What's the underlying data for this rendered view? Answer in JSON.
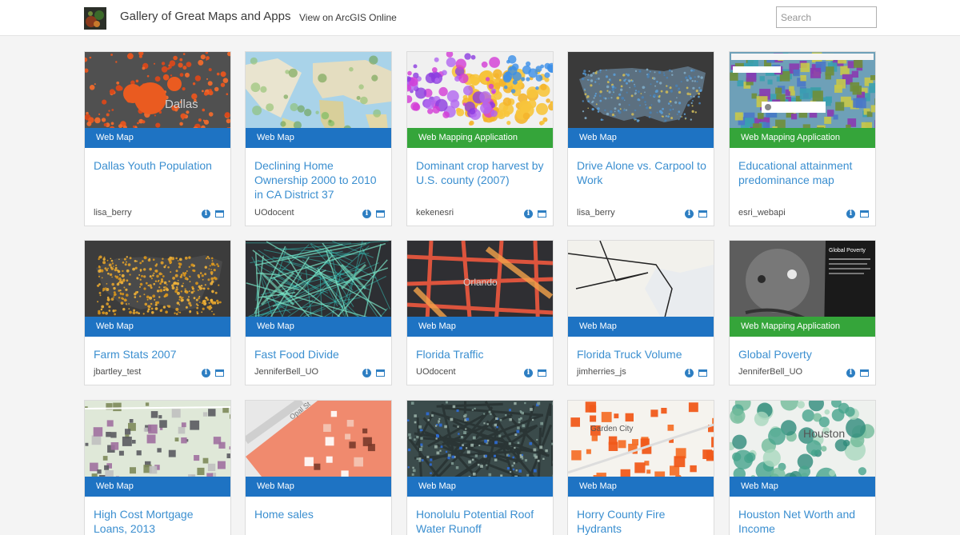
{
  "header": {
    "title": "Gallery of Great Maps and Apps",
    "view_link": "View on ArcGIS Online",
    "search_placeholder": "Search"
  },
  "colors": {
    "web_map_ribbon": "#1e73c3",
    "app_ribbon": "#35a53a",
    "title_link": "#3b8fd0",
    "icon_blue": "#2d7ec2"
  },
  "icons": {
    "info": "info-icon",
    "details": "details-icon",
    "logo": "gallery-logo"
  },
  "cards": [
    {
      "type": "Web Map",
      "title": "Dallas Youth Population",
      "owner": "lisa_berry",
      "thumb": "dallas"
    },
    {
      "type": "Web Map",
      "title": "Declining Home Ownership 2000 to 2010 in CA District 37",
      "owner": "UOdocent",
      "thumb": "world"
    },
    {
      "type": "Web Mapping Application",
      "title": "Dominant crop harvest by U.S. county (2007)",
      "owner": "kekenesri",
      "thumb": "crop"
    },
    {
      "type": "Web Map",
      "title": "Drive Alone vs. Carpool to Work",
      "owner": "lisa_berry",
      "thumb": "usdark"
    },
    {
      "type": "Web Mapping Application",
      "title": "Educational attainment predominance map",
      "owner": "esri_webapi",
      "thumb": "edu"
    },
    {
      "type": "Web Map",
      "title": "Farm Stats 2007",
      "owner": "jbartley_test",
      "thumb": "farm"
    },
    {
      "type": "Web Map",
      "title": "Fast Food Divide",
      "owner": "JenniferBell_UO",
      "thumb": "fastfood"
    },
    {
      "type": "Web Map",
      "title": "Florida Traffic",
      "owner": "UOdocent",
      "thumb": "traffic"
    },
    {
      "type": "Web Map",
      "title": "Florida Truck Volume",
      "owner": "jimherries_js",
      "thumb": "truck"
    },
    {
      "type": "Web Mapping Application",
      "title": "Global Poverty",
      "owner": "JenniferBell_UO",
      "thumb": "poverty"
    },
    {
      "type": "Web Map",
      "title": "High Cost Mortgage Loans, 2013",
      "owner": "",
      "thumb": "mortgage"
    },
    {
      "type": "Web Map",
      "title": "Home sales",
      "owner": "",
      "thumb": "homesales"
    },
    {
      "type": "Web Map",
      "title": "Honolulu Potential Roof Water Runoff",
      "owner": "",
      "thumb": "honolulu"
    },
    {
      "type": "Web Map",
      "title": "Horry County Fire Hydrants",
      "owner": "",
      "thumb": "horry"
    },
    {
      "type": "Web Map",
      "title": "Houston Net Worth and Income",
      "owner": "",
      "thumb": "houston"
    }
  ],
  "thumb_labels": {
    "dallas": "Dallas",
    "traffic": "Orlando",
    "horry": "Garden City",
    "houston": "Houston",
    "homesales": "Opal St",
    "poverty": "Global Poverty"
  }
}
